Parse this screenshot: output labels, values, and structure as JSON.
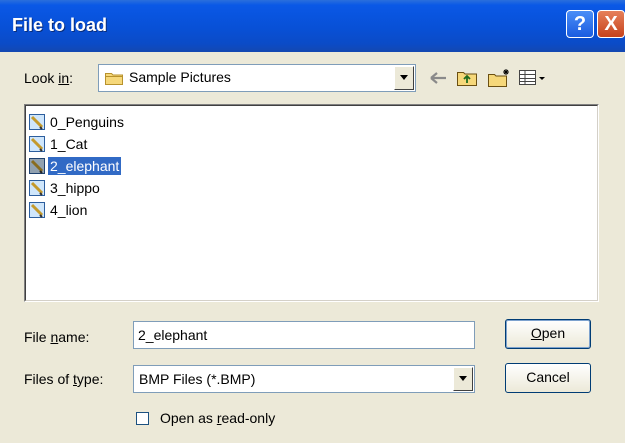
{
  "dialog": {
    "title": "File to load",
    "help_label": "?",
    "close_label": "X"
  },
  "look_in": {
    "label": "Look in:",
    "label_key": "i",
    "value": "Sample Pictures"
  },
  "files": [
    {
      "name": "0_Penguins",
      "selected": false
    },
    {
      "name": "1_Cat",
      "selected": false
    },
    {
      "name": "2_elephant",
      "selected": true
    },
    {
      "name": "3_hippo",
      "selected": false
    },
    {
      "name": "4_lion",
      "selected": false
    }
  ],
  "file_name": {
    "label": "File name:",
    "value": "2_elephant"
  },
  "file_type": {
    "label": "Files of type:",
    "value": "BMP Files (*.BMP)"
  },
  "read_only": {
    "label": "Open as read-only",
    "checked": false
  },
  "buttons": {
    "open": "Open",
    "cancel": "Cancel"
  },
  "toolbar": {
    "back_icon": "back-arrow-icon",
    "up_icon": "up-folder-icon",
    "new_folder_icon": "new-folder-icon",
    "view_icon": "view-menu-icon"
  },
  "colors": {
    "titlebar": "#0a58e6",
    "selection": "#316ac5",
    "dialog_bg": "#ece9d8"
  }
}
